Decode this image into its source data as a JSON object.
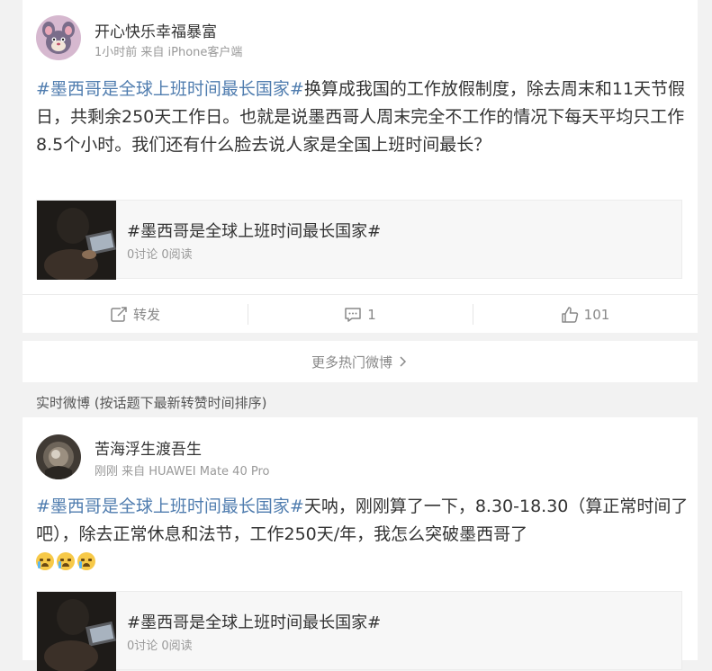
{
  "post1": {
    "username": "开心快乐幸福暴富",
    "meta": "1小时前 来自 iPhone客户端",
    "hashtag": "#墨西哥是全球上班时间最长国家#",
    "body": "换算成我国的工作放假制度，除去周末和11天节假日，共剩余250天工作日。也就是说墨西哥人周末完全不工作的情况下每天平均只工作8.5个小时。我们还有什么脸去说人家是全国上班时间最长？",
    "topic_title": "#墨西哥是全球上班时间最长国家#",
    "topic_stats": "0讨论 0阅读",
    "actions": {
      "repost": "转发",
      "comment": "1",
      "like": "101"
    }
  },
  "more_label": "更多热门微博",
  "section_title": "实时微博 (按话题下最新转赞时间排序)",
  "post2": {
    "username": "苦海浮生渡吾生",
    "meta": "刚刚 来自 HUAWEI Mate 40 Pro",
    "hashtag": "#墨西哥是全球上班时间最长国家#",
    "body": "天呐，刚刚算了一下，8.30-18.30（算正常时间了吧），除去正常休息和法节，工作250天/年，我怎么突破墨西哥了",
    "emoji_count_label": "[泪][泪][泪]",
    "topic_title": "#墨西哥是全球上班时间最长国家#",
    "topic_stats": "0讨论 0阅读"
  },
  "colors": {
    "hashtag": "#507daf",
    "meta": "#999999",
    "background": "#f2f2f2"
  }
}
